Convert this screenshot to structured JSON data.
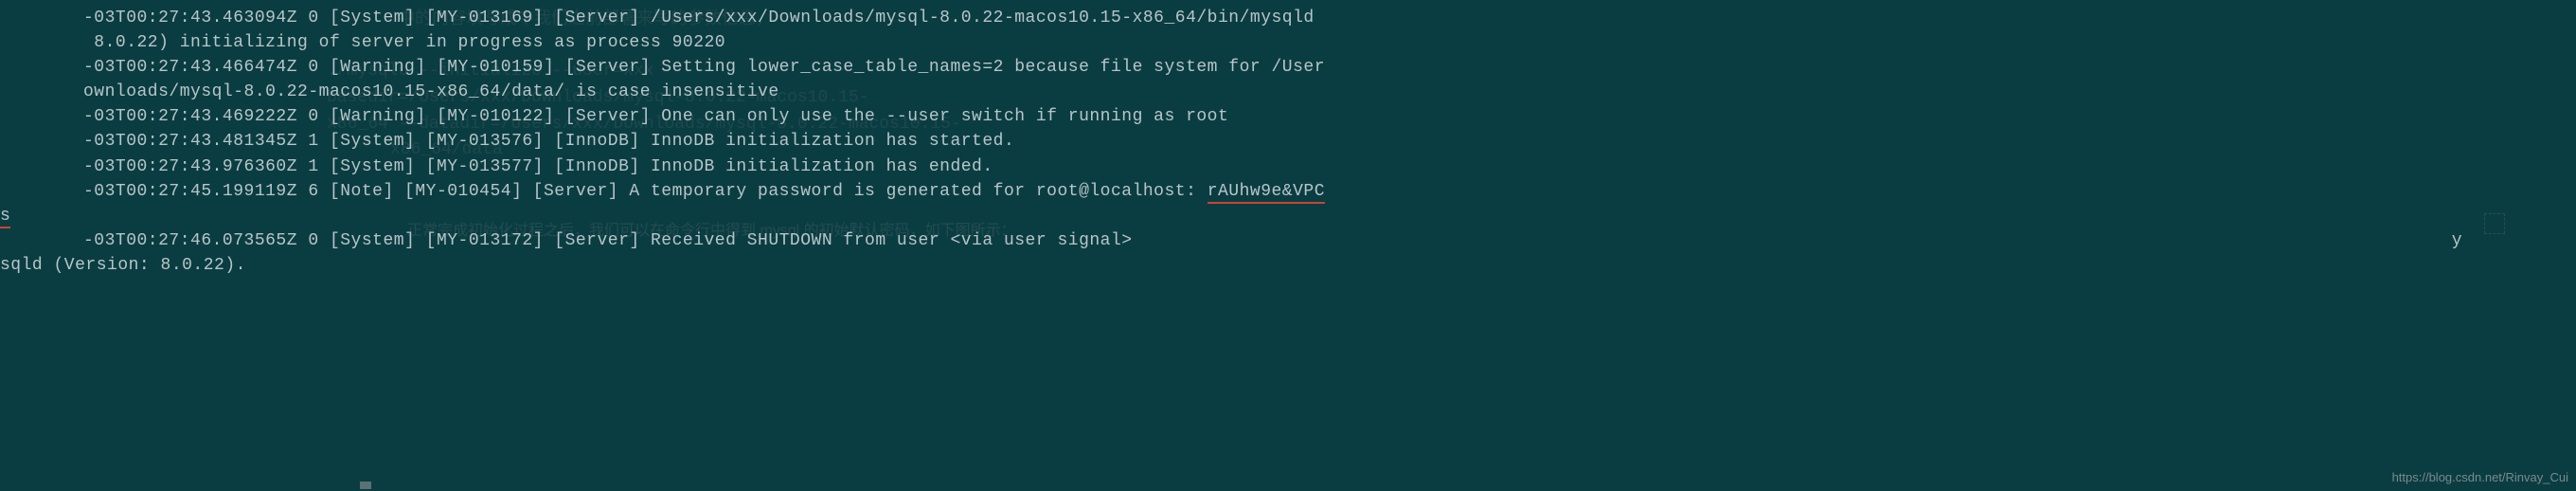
{
  "log": {
    "lines": [
      "-03T00:27:43.463094Z 0 [System] [MY-013169] [Server] /Users/xxx/Downloads/mysql-8.0.22-macos10.15-x86_64/bin/mysqld",
      " 8.0.22) initializing of server in progress as process 90220",
      "-03T00:27:43.466474Z 0 [Warning] [MY-010159] [Server] Setting lower_case_table_names=2 because file system for /User",
      "ownloads/mysql-8.0.22-macos10.15-x86_64/data/ is case insensitive",
      "-03T00:27:43.469222Z 0 [Warning] [MY-010122] [Server] One can only use the --user switch if running as root",
      "-03T00:27:43.481345Z 1 [System] [MY-013576] [InnoDB] InnoDB initialization has started.",
      "-03T00:27:43.976360Z 1 [System] [MY-013577] [InnoDB] InnoDB initialization has ended.",
      "-03T00:27:45.199119Z 6 [Note] [MY-010454] [Server] A temporary password is generated for root@localhost: ",
      "s",
      "",
      "-03T00:27:46.073565Z 0 [System] [MY-013172] [Server] Received SHUTDOWN from user <via user signal>",
      "sqld (Version: 8.0.22)."
    ],
    "password": "rAUhw9e&VPC",
    "trailing_y": "y"
  },
  "ghost": {
    "g1": "中的内容填写成中我们之前部署来写的参数信息，",
    "g2": "./mysqld --initialize --user=xxx ",
    "g3": "basedir=/Users/xxx/Downloads/mysql-8.0.22-macos10.15-",
    "g4": "x86_64 --datadir=/Users/xxx/Downloads/mysql-8.0.22-macos10.15-",
    "g5": "x86_64/data",
    "g6": "",
    "g7": "正常完成初始化过程之后，我们可以在命令行中得到 mysql 的初始默认密码，如下图所示："
  },
  "watermark": "https://blog.csdn.net/Rinvay_Cui"
}
